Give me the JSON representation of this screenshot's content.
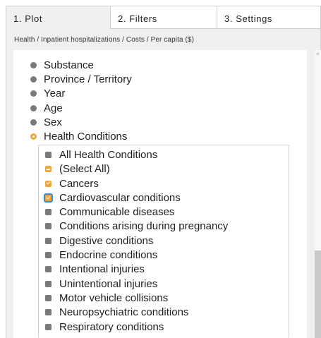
{
  "tabs": [
    {
      "label": "1. Plot",
      "active": true
    },
    {
      "label": "2. Filters",
      "active": false
    },
    {
      "label": "3. Settings",
      "active": false
    }
  ],
  "breadcrumb": "Health / Inpatient hospitalizations / Costs / Per capita ($)",
  "dimensions": [
    {
      "label": "Substance",
      "state": "collapsed"
    },
    {
      "label": "Province / Territory",
      "state": "collapsed"
    },
    {
      "label": "Year",
      "state": "collapsed"
    },
    {
      "label": "Age",
      "state": "collapsed"
    },
    {
      "label": "Sex",
      "state": "collapsed"
    },
    {
      "label": "Health Conditions",
      "state": "expanded"
    }
  ],
  "health_conditions": [
    {
      "label": "All Health Conditions",
      "state": "unchecked"
    },
    {
      "label": "(Select All)",
      "state": "partial"
    },
    {
      "label": "Cancers",
      "state": "checked"
    },
    {
      "label": "Cardiovascular conditions",
      "state": "checked-focused"
    },
    {
      "label": "Communicable diseases",
      "state": "unchecked"
    },
    {
      "label": "Conditions arising during pregnancy",
      "state": "unchecked"
    },
    {
      "label": "Digestive conditions",
      "state": "unchecked"
    },
    {
      "label": "Endocrine conditions",
      "state": "unchecked"
    },
    {
      "label": "Intentional injuries",
      "state": "unchecked"
    },
    {
      "label": "Unintentional injuries",
      "state": "unchecked"
    },
    {
      "label": "Motor vehicle collisions",
      "state": "unchecked"
    },
    {
      "label": "Neuropsychiatric conditions",
      "state": "unchecked"
    },
    {
      "label": "Respiratory conditions",
      "state": "unchecked"
    }
  ],
  "colors": {
    "accent": "#f0a637",
    "focus": "#3b8fd8",
    "bullet": "#7a7a7a"
  }
}
